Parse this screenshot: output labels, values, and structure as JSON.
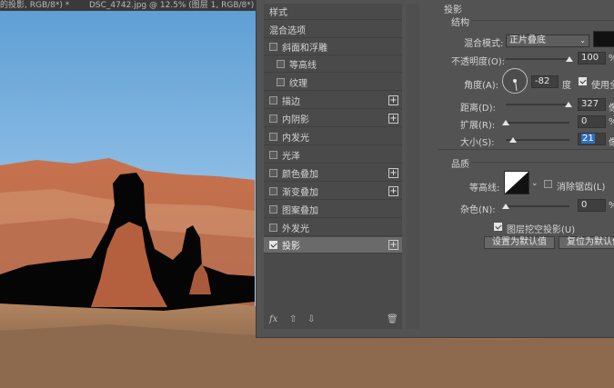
{
  "document_tabs": [
    {
      "label": "的投影, RGB/8*) *"
    },
    {
      "label": "DSC_4742.jpg @ 12.5% (图层 1, RGB/8*) *"
    }
  ],
  "style_list": {
    "header": "样式",
    "items": [
      {
        "label": "混合选项",
        "checkbox": false,
        "indent": false,
        "plus": false,
        "checked": false,
        "selected": false
      },
      {
        "label": "斜面和浮雕",
        "checkbox": true,
        "indent": false,
        "plus": false,
        "checked": false,
        "selected": false
      },
      {
        "label": "等高线",
        "checkbox": true,
        "indent": true,
        "plus": false,
        "checked": false,
        "selected": false
      },
      {
        "label": "纹理",
        "checkbox": true,
        "indent": true,
        "plus": false,
        "checked": false,
        "selected": false
      },
      {
        "label": "描边",
        "checkbox": true,
        "indent": false,
        "plus": true,
        "checked": false,
        "selected": false
      },
      {
        "label": "内阴影",
        "checkbox": true,
        "indent": false,
        "plus": true,
        "checked": false,
        "selected": false
      },
      {
        "label": "内发光",
        "checkbox": true,
        "indent": false,
        "plus": false,
        "checked": false,
        "selected": false
      },
      {
        "label": "光泽",
        "checkbox": true,
        "indent": false,
        "plus": false,
        "checked": false,
        "selected": false
      },
      {
        "label": "颜色叠加",
        "checkbox": true,
        "indent": false,
        "plus": true,
        "checked": false,
        "selected": false
      },
      {
        "label": "渐变叠加",
        "checkbox": true,
        "indent": false,
        "plus": true,
        "checked": false,
        "selected": false
      },
      {
        "label": "图案叠加",
        "checkbox": true,
        "indent": false,
        "plus": false,
        "checked": false,
        "selected": false
      },
      {
        "label": "外发光",
        "checkbox": true,
        "indent": false,
        "plus": false,
        "checked": false,
        "selected": false
      },
      {
        "label": "投影",
        "checkbox": true,
        "indent": false,
        "plus": true,
        "checked": true,
        "selected": true
      }
    ],
    "footer": {
      "fx": "fx",
      "up": "⇧",
      "down": "⇩",
      "trash": "🗑"
    }
  },
  "drop_shadow": {
    "title": "投影",
    "structure": {
      "heading": "结构",
      "blend_mode_label": "混合模式:",
      "blend_mode_value": "正片叠底",
      "shadow_color": "#111111",
      "opacity_label": "不透明度(O):",
      "opacity_value": "100",
      "opacity_unit": "%",
      "opacity_fraction": 1.0,
      "angle_label": "角度(A):",
      "angle_value": "-82",
      "angle_unit": "度",
      "global_light_label": "使用全局光",
      "global_light_checked": true,
      "distance_label": "距离(D):",
      "distance_value": "327",
      "distance_unit": "像素",
      "distance_fraction": 0.99,
      "spread_label": "扩展(R):",
      "spread_value": "0",
      "spread_unit": "%",
      "spread_fraction": 0.0,
      "size_label": "大小(S):",
      "size_value": "21",
      "size_unit": "像素",
      "size_fraction": 0.12
    },
    "quality": {
      "heading": "品质",
      "contour_label": "等高线:",
      "anti_alias_label": "消除锯齿(L)",
      "anti_alias_checked": false,
      "noise_label": "杂色(N):",
      "noise_value": "0",
      "noise_unit": "%",
      "noise_fraction": 0.0
    },
    "knockout_label": "图层挖空投影(U)",
    "knockout_checked": true,
    "make_default_button": "设置为默认值",
    "reset_default_button": "复位为默认值"
  }
}
